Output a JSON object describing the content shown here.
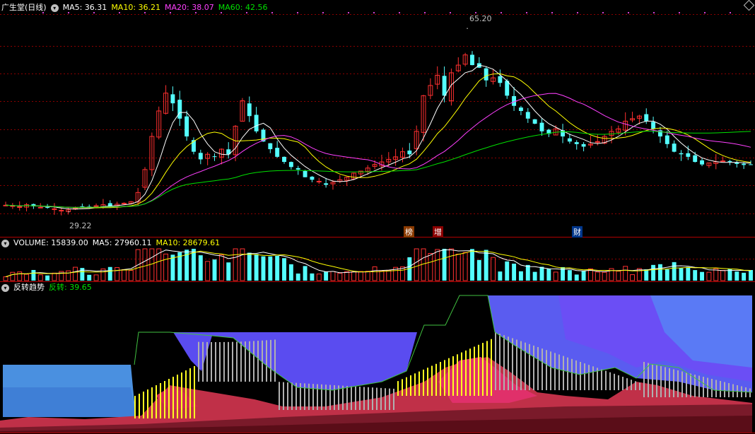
{
  "main": {
    "title": "广生堂(日线)",
    "ma5_label": "MA5: 36.31",
    "ma10_label": "MA10: 36.21",
    "ma20_label": "MA20: 38.07",
    "ma60_label": "MA60: 42.56",
    "high_label": "65.20",
    "low_label": "29.22",
    "events": [
      "榜",
      "增",
      "财"
    ]
  },
  "volume": {
    "title": "VOLUME: 15839.00",
    "ma5_label": "MA5: 27960.11",
    "ma10_label": "MA10: 28679.61"
  },
  "indicator": {
    "title": "反转趋势",
    "value_label": "反转: 39.65"
  },
  "colors": {
    "up": "#ff3030",
    "down": "#54ffff",
    "ma5": "#ffffff",
    "ma10": "#ffff00",
    "ma20": "#ff40ff",
    "ma60": "#00e000",
    "grid": "#8b0000"
  },
  "chart_data": {
    "type": "candlestick",
    "title": "广生堂(日线)",
    "close_approx": [
      30.5,
      30.4,
      30.2,
      30.6,
      30.3,
      30.1,
      30.0,
      29.8,
      29.5,
      29.6,
      29.9,
      30.2,
      30.1,
      30.4,
      30.6,
      30.3,
      30.7,
      30.9,
      31.2,
      33.0,
      37.5,
      44.0,
      49.0,
      52.5,
      50.5,
      47.5,
      44.0,
      41.0,
      39.5,
      40.5,
      40.0,
      41.5,
      40.5,
      46.0,
      51.0,
      48.0,
      45.0,
      43.0,
      41.5,
      40.0,
      39.0,
      38.0,
      37.5,
      36.0,
      35.5,
      35.2,
      34.5,
      35.0,
      35.5,
      36.0,
      36.8,
      37.2,
      37.8,
      38.5,
      39.0,
      39.5,
      40.0,
      41.0,
      40.5,
      45.0,
      52.0,
      54.0,
      56.0,
      52.0,
      56.5,
      58.0,
      60.0,
      58.0,
      57.5,
      55.0,
      55.5,
      54.5,
      52.0,
      50.0,
      49.0,
      47.5,
      46.5,
      45.0,
      44.5,
      45.5,
      44.0,
      43.0,
      42.5,
      42.0,
      42.5,
      43.0,
      44.0,
      45.0,
      45.5,
      47.0,
      47.5,
      48.0,
      47.0,
      45.5,
      44.0,
      42.5,
      41.0,
      40.5,
      40.0,
      39.0,
      38.5,
      38.8,
      39.0,
      39.2,
      39.0,
      38.6,
      38.4,
      38.5
    ],
    "extremes": {
      "high": 65.2,
      "low": 29.22
    }
  }
}
